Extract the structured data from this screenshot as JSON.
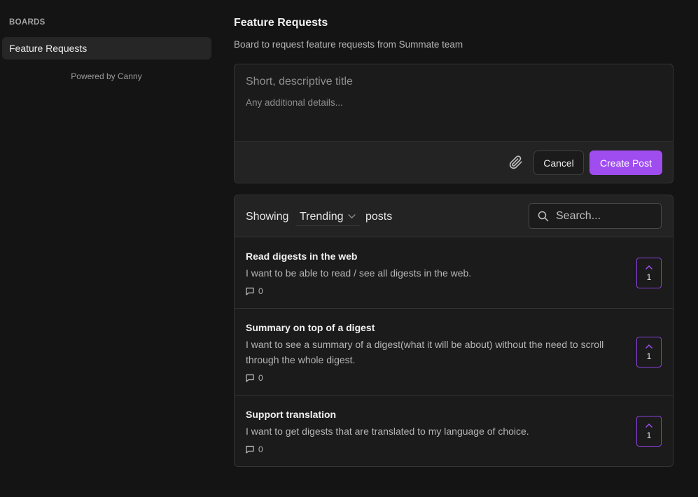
{
  "sidebar": {
    "boards_heading": "BOARDS",
    "active_board": "Feature Requests",
    "powered_by": "Powered by Canny"
  },
  "board": {
    "title": "Feature Requests",
    "description": "Board to request feature requests from Summate team"
  },
  "composer": {
    "title_placeholder": "Short, descriptive title",
    "details_placeholder": "Any additional details...",
    "attach_icon": "paperclip-icon",
    "cancel_label": "Cancel",
    "create_label": "Create Post"
  },
  "posts_list": {
    "showing_label": "Showing",
    "sort_value": "Trending",
    "posts_label": "posts",
    "search_placeholder": "Search...",
    "items": [
      {
        "title": "Read digests in the web",
        "body": "I want to be able to read / see all digests in the web.",
        "comments": "0",
        "votes": "1"
      },
      {
        "title": "Summary on top of a digest",
        "body": "I want to see a summary of a digest(what it will be about) without the need to scroll through the whole digest.",
        "comments": "0",
        "votes": "1"
      },
      {
        "title": "Support translation",
        "body": "I want to get digests that are translated to my language of choice.",
        "comments": "0",
        "votes": "1"
      }
    ]
  },
  "colors": {
    "accent": "#a04df0",
    "vote_border": "#8b3fd9",
    "background": "#141414"
  }
}
